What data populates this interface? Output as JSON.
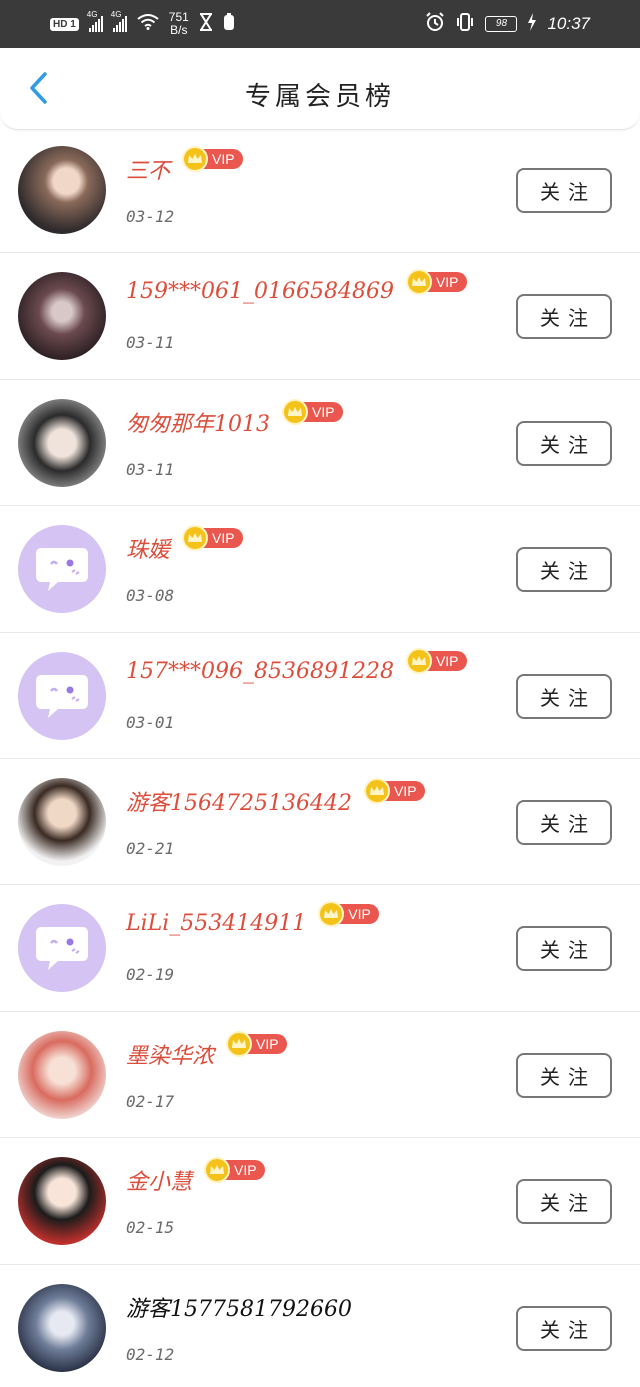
{
  "status_bar": {
    "hd": "HD",
    "sim": "1",
    "net1": "4G",
    "net2": "4G",
    "speed_value": "751",
    "speed_unit": "B/s",
    "battery": "98",
    "time": "10:37"
  },
  "header": {
    "title": "专属会员榜"
  },
  "vip_label": "VIP",
  "follow_label": "关注",
  "members": [
    {
      "name": "三不",
      "date": "03-12",
      "vip": true,
      "avatar": "photo-girl-dark"
    },
    {
      "name": "159***061_0166584869",
      "date": "03-11",
      "vip": true,
      "avatar": "photo-reclining"
    },
    {
      "name": "匆匆那年1013",
      "date": "03-11",
      "vip": true,
      "avatar": "photo-actor-costume"
    },
    {
      "name": "珠媛",
      "date": "03-08",
      "vip": true,
      "avatar": "default-chat"
    },
    {
      "name": "157***096_8536891228",
      "date": "03-01",
      "vip": true,
      "avatar": "default-chat"
    },
    {
      "name": "游客1564725136442",
      "date": "02-21",
      "vip": true,
      "avatar": "photo-man-suit"
    },
    {
      "name": "LiLi_553414911",
      "date": "02-19",
      "vip": true,
      "avatar": "default-chat"
    },
    {
      "name": "墨染华浓",
      "date": "02-17",
      "vip": true,
      "avatar": "illustration-redhair"
    },
    {
      "name": "金小慧",
      "date": "02-15",
      "vip": true,
      "avatar": "illustration-cartoon"
    },
    {
      "name": "游客1577581792660",
      "date": "02-12",
      "vip": false,
      "avatar": "illustration-anime"
    }
  ],
  "colors": {
    "vip_name": "#dc4d3b",
    "vip_badge": "#e9574e",
    "crown": "#f5c21a",
    "default_avatar": "#d4c3f3",
    "back_arrow": "#2f9be8"
  }
}
